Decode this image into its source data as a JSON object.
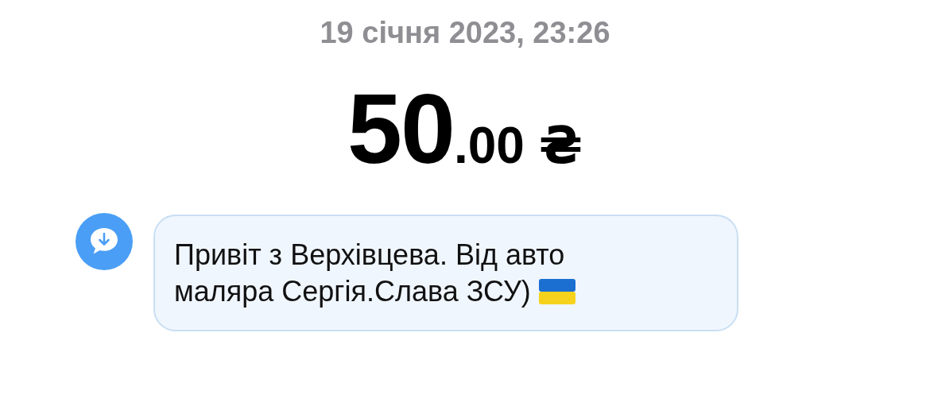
{
  "date": "19 січня 2023, 23:26",
  "amount": {
    "whole": "50",
    "fraction": ".00",
    "currency": "₴"
  },
  "message": {
    "lines": [
      "Привіт з Верхівцева. Від авто",
      "маляра Сергія.Слава ЗСУ)"
    ]
  }
}
